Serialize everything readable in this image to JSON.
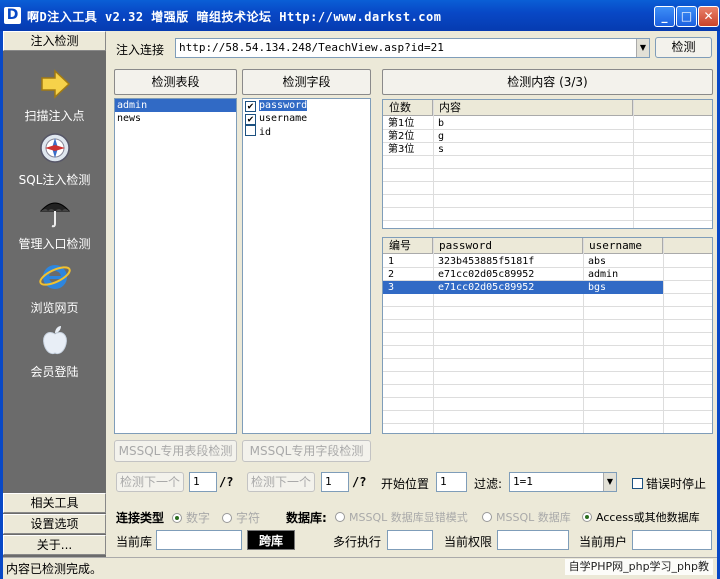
{
  "window": {
    "title": "啊D注入工具 v2.32 增强版 暗组技术论坛 Http://www.darkst.com",
    "icon_letter": "D"
  },
  "nav": {
    "top_tab": "注入检测",
    "items": [
      {
        "label": "扫描注入点",
        "icon": "arrow-right-icon"
      },
      {
        "label": "SQL注入检测",
        "icon": "compass-icon"
      },
      {
        "label": "管理入口检测",
        "icon": "umbrella-icon"
      },
      {
        "label": "浏览网页",
        "icon": "ie-browser-icon"
      },
      {
        "label": "会员登陆",
        "icon": "apple-icon"
      }
    ],
    "bottom_tabs": [
      "相关工具",
      "设置选项",
      "关于..."
    ]
  },
  "url_bar": {
    "label": "注入连接",
    "value": "http://58.54.134.248/TeachView.asp?id=21",
    "detect_button": "检测"
  },
  "tables_panel": {
    "header": "检测表段",
    "items": [
      "admin",
      "news"
    ],
    "selected": 0,
    "mssql_button": "MSSQL专用表段检测",
    "next_button": "检测下一个",
    "next_value": "1",
    "next_suffix": "/?"
  },
  "fields_panel": {
    "header": "检测字段",
    "items": [
      {
        "label": "password",
        "checked": true
      },
      {
        "label": "username",
        "checked": true
      },
      {
        "label": "id",
        "checked": false
      }
    ],
    "selected": 0,
    "mssql_button": "MSSQL专用字段检测",
    "next_button": "检测下一个",
    "next_value": "1",
    "next_suffix": "/?"
  },
  "content_panel": {
    "header": "检测内容 (3/3)",
    "digits_columns": [
      "位数",
      "内容"
    ],
    "digits_rows": [
      [
        "第1位",
        "b"
      ],
      [
        "第2位",
        "g"
      ],
      [
        "第3位",
        "s"
      ]
    ],
    "results_columns": [
      "编号",
      "password",
      "username"
    ],
    "results_rows": [
      [
        "1",
        "323b453885f5181f",
        "abs"
      ],
      [
        "2",
        "e71cc02d05c89952",
        "admin"
      ],
      [
        "3",
        "e71cc02d05c89952",
        "bgs"
      ]
    ],
    "selected_row": 2
  },
  "options": {
    "start_label": "开始位置",
    "start_value": "1",
    "filter_label": "过滤:",
    "filter_value": "1=1",
    "stop_on_error_label": "错误时停止"
  },
  "connection": {
    "type_label": "连接类型",
    "type_options": [
      "数字",
      "字符"
    ],
    "type_selected": 0,
    "db_label": "数据库:",
    "db_options": [
      "MSSQL 数据库显错模式",
      "MSSQL 数据库",
      "Access或其他数据库"
    ],
    "db_selected": 2
  },
  "info": {
    "current_db_label": "当前库",
    "current_db_value": "",
    "cross_db_button": "跨库",
    "multi_exec_label": "多行执行",
    "multi_exec_value": "",
    "permission_label": "当前权限",
    "permission_value": "",
    "user_label": "当前用户",
    "user_value": ""
  },
  "status": {
    "text": "内容已检测完成。",
    "watermark": "自学PHP网_php学习_php教"
  },
  "colors": {
    "titlebar": "#0848c6",
    "nav_bg": "#6b6b6b",
    "selection": "#316ac5"
  }
}
